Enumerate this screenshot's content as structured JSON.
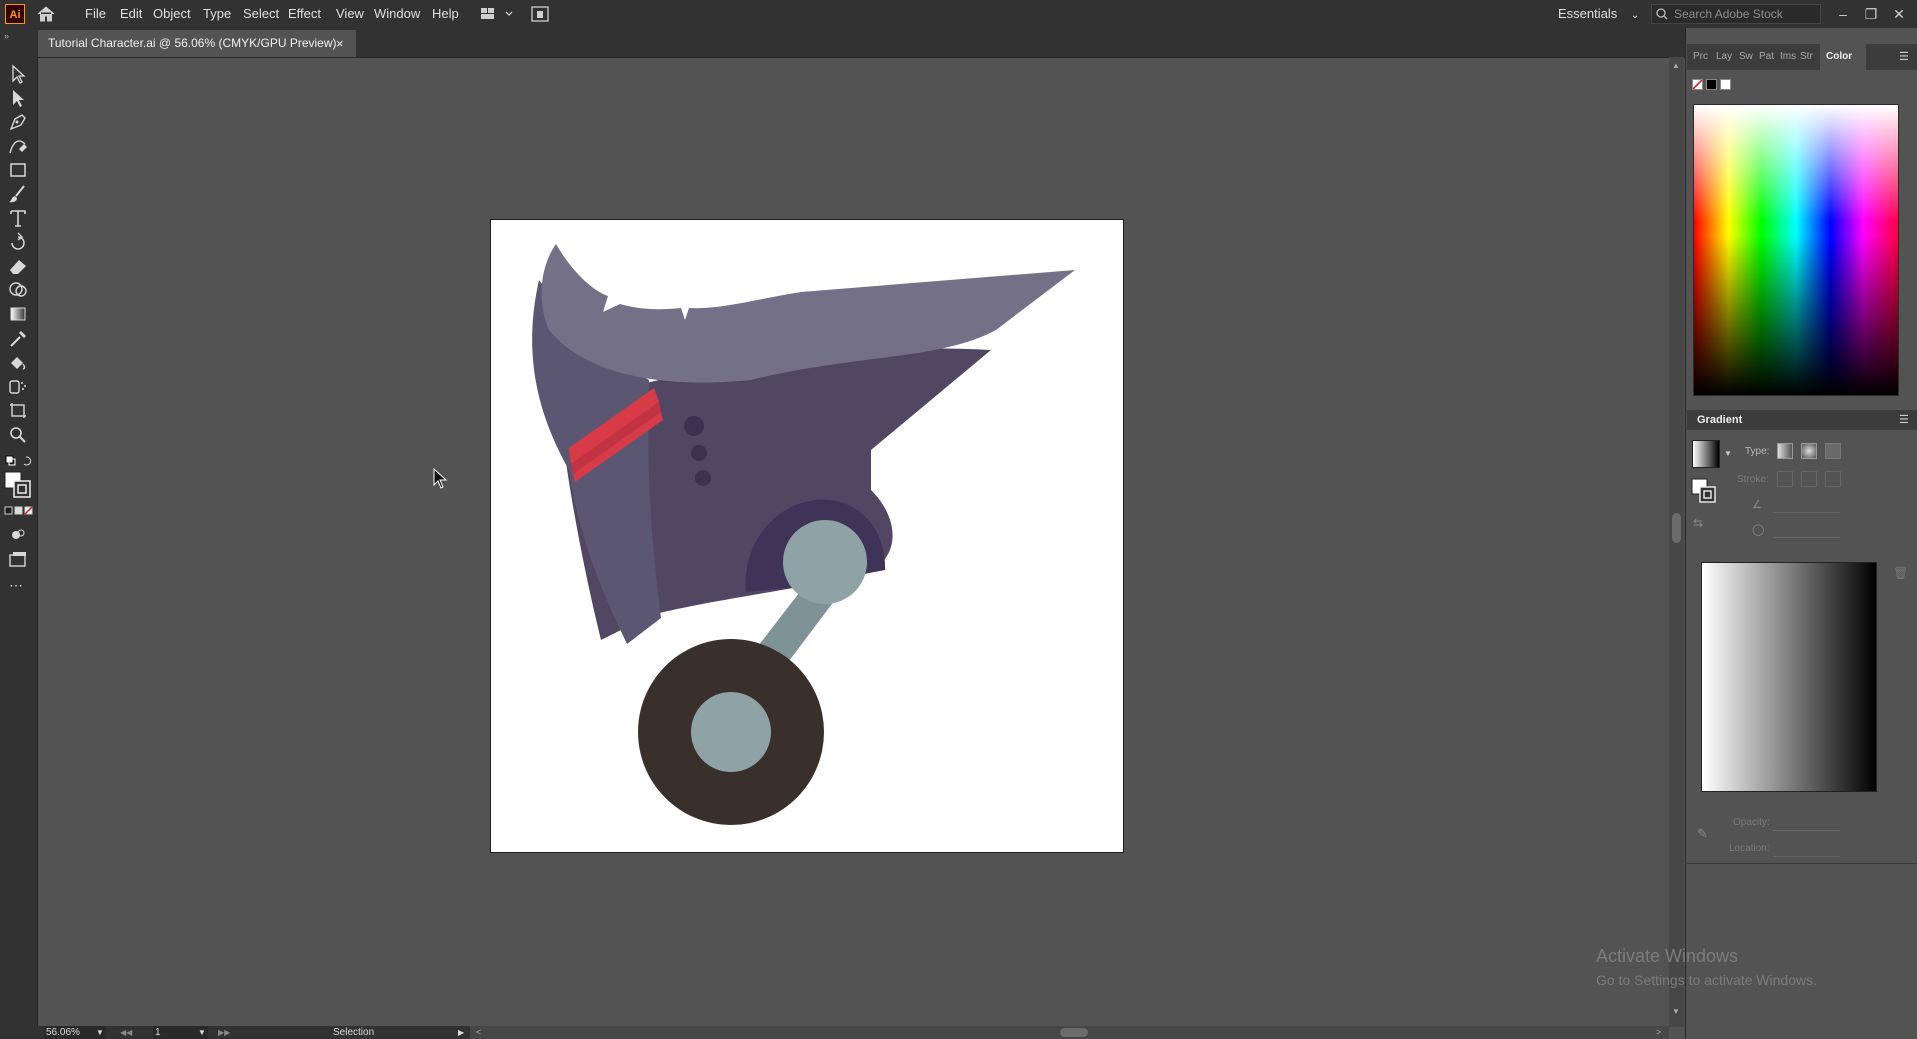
{
  "app": {
    "logo": "Ai"
  },
  "menu": [
    "File",
    "Edit",
    "Object",
    "Type",
    "Select",
    "Effect",
    "View",
    "Window",
    "Help"
  ],
  "workspace": "Essentials",
  "search": {
    "placeholder": "Search Adobe Stock"
  },
  "document_tab": {
    "title": "Tutorial Character.ai @ 56.06% (CMYK/GPU Preview)",
    "close": "×"
  },
  "status": {
    "zoom": "56.06%",
    "page": "1",
    "tool_status": "Selection"
  },
  "panels": {
    "tabs": [
      "Prc",
      "Lay",
      "Sw",
      "Pat",
      "Ims",
      "Str",
      "Color"
    ],
    "gradient": {
      "title": "Gradient",
      "type_label": "Type:",
      "stroke_label": "Stroke:",
      "opacity_label": "Opacity:",
      "location_label": "Location:"
    }
  },
  "watermark": {
    "title": "Activate Windows",
    "subtitle": "Go to Settings to activate Windows."
  },
  "colors": {
    "ui_dark": "#323232",
    "canvas_bg": "#535353",
    "artboard": "#ffffff",
    "accent_logo": "#ff9a00",
    "art_light": "#737088",
    "art_mid": "#5b5672",
    "art_dark": "#524762",
    "art_red": "#d93a48",
    "art_wheel": "#3a302b",
    "art_joint": "#8fa3a7"
  }
}
